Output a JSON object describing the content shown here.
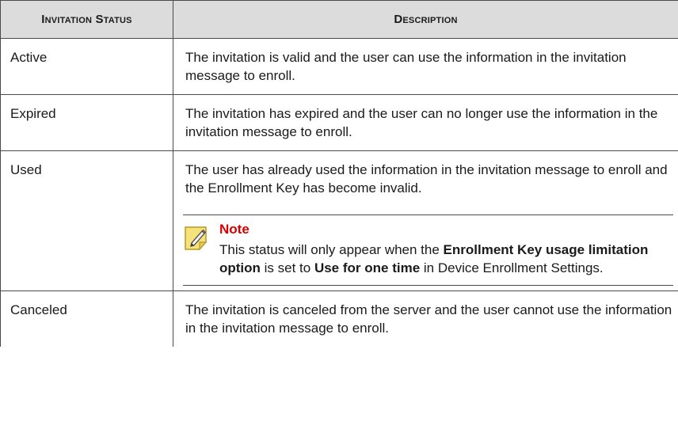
{
  "table": {
    "headers": {
      "status": "Invitation Status",
      "description": "Description"
    },
    "rows": [
      {
        "status": "Active",
        "description": "The invitation is valid and the user can use the information in the invitation message to enroll."
      },
      {
        "status": "Expired",
        "description": "The invitation has expired and the user can no longer use the information in the invitation message to enroll."
      },
      {
        "status": "Used",
        "description": "The user has already used the information in the invitation message to enroll and the Enrollment Key has become invalid."
      },
      {
        "status": "Canceled",
        "description": "The invitation is canceled from the server and the user cannot use the information in the invitation message to enroll."
      }
    ]
  },
  "note": {
    "title": "Note",
    "text_1": "This status will only appear when the ",
    "bold_1": "Enrollment Key usage limitation option",
    "text_2": " is set to ",
    "bold_2": "Use for one time",
    "text_3": " in Device Enrollment Settings."
  },
  "colors": {
    "header_background": "#dcdcdc",
    "note_title": "#d60000",
    "note_icon_fill": "#f6e27a"
  },
  "icons": {
    "note": "note-pencil-icon"
  }
}
